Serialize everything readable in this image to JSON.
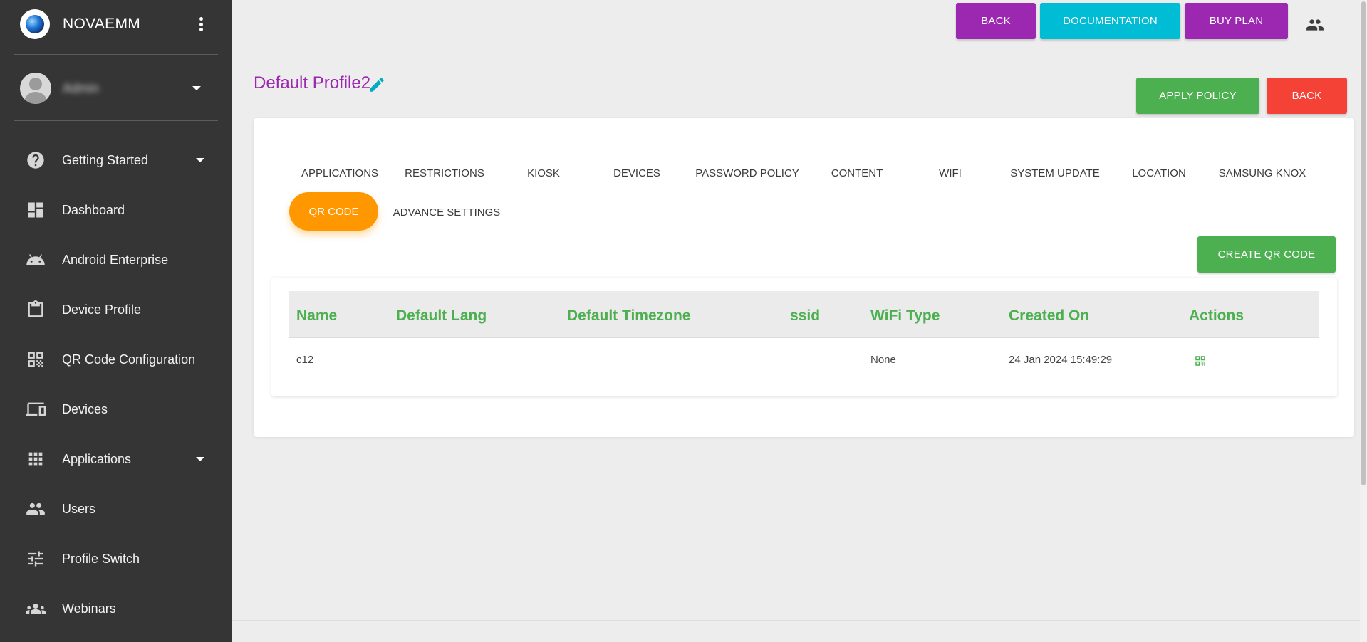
{
  "sidebar": {
    "brand": "NOVAEMM",
    "user_name": "Admin",
    "items": [
      {
        "label": "Getting Started",
        "icon": "help-circle-icon",
        "expandable": true
      },
      {
        "label": "Dashboard",
        "icon": "dashboard-icon",
        "expandable": false
      },
      {
        "label": "Android Enterprise",
        "icon": "android-icon",
        "expandable": false
      },
      {
        "label": "Device Profile",
        "icon": "clipboard-icon",
        "expandable": false
      },
      {
        "label": "QR Code Configuration",
        "icon": "qr-code-icon",
        "expandable": false
      },
      {
        "label": "Devices",
        "icon": "devices-icon",
        "expandable": false
      },
      {
        "label": "Applications",
        "icon": "apps-grid-icon",
        "expandable": true
      },
      {
        "label": "Users",
        "icon": "people-icon",
        "expandable": false
      },
      {
        "label": "Profile Switch",
        "icon": "tune-icon",
        "expandable": false
      },
      {
        "label": "Webinars",
        "icon": "groups-icon",
        "expandable": false
      }
    ]
  },
  "header": {
    "back_label": "BACK",
    "documentation_label": "DOCUMENTATION",
    "buy_plan_label": "BUY PLAN",
    "account_icon": "people-icon"
  },
  "profile": {
    "title": "Default Profile2",
    "apply_policy_label": "APPLY POLICY",
    "back_label": "BACK"
  },
  "tabs": {
    "items": [
      "APPLICATIONS",
      "RESTRICTIONS",
      "KIOSK",
      "DEVICES",
      "PASSWORD POLICY",
      "CONTENT",
      "WIFI",
      "SYSTEM UPDATE",
      "LOCATION",
      "SAMSUNG KNOX",
      "QR CODE",
      "ADVANCE SETTINGS"
    ],
    "active": "QR CODE"
  },
  "qr": {
    "create_label": "CREATE QR CODE",
    "columns": [
      "Name",
      "Default Lang",
      "Default Timezone",
      "ssid",
      "WiFi Type",
      "Created On",
      "Actions"
    ],
    "rows": [
      {
        "name": "c12",
        "default_lang": "",
        "default_timezone": "",
        "ssid": "",
        "wifi_type": "None",
        "created_on": "24 Jan 2024 15:49:29",
        "action_icon": "qr-code-icon"
      }
    ]
  },
  "colors": {
    "sidebar_bg": "#353535",
    "purple": "#9c27b0",
    "cyan": "#00bcd4",
    "green": "#4caf50",
    "red": "#f44336",
    "orange": "#ff9800"
  }
}
